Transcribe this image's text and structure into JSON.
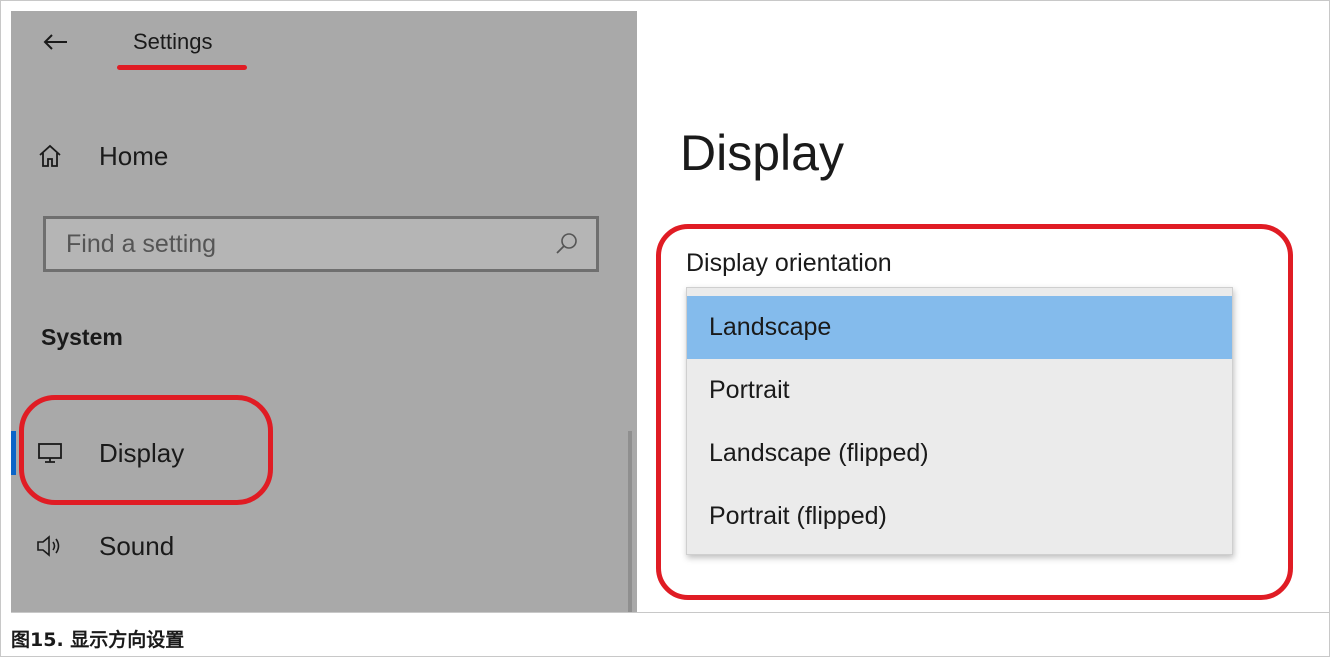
{
  "app": {
    "title": "Settings"
  },
  "sidebar": {
    "home_label": "Home",
    "search": {
      "placeholder": "Find a setting",
      "value": ""
    },
    "section_label": "System",
    "items": [
      {
        "label": "Display",
        "icon": "monitor-icon",
        "selected": true
      },
      {
        "label": "Sound",
        "icon": "speaker-icon",
        "selected": false
      }
    ]
  },
  "main": {
    "title": "Display",
    "orientation": {
      "label": "Display orientation",
      "selected": "Landscape",
      "options": [
        "Landscape",
        "Portrait",
        "Landscape (flipped)",
        "Portrait (flipped)"
      ]
    }
  },
  "caption": "图15. 显示方向设置",
  "colors": {
    "accent": "#0a64c8",
    "selected_option": "#84bbec",
    "annotation_red": "#e01c24",
    "sidebar_bg": "#a9a9a9"
  }
}
